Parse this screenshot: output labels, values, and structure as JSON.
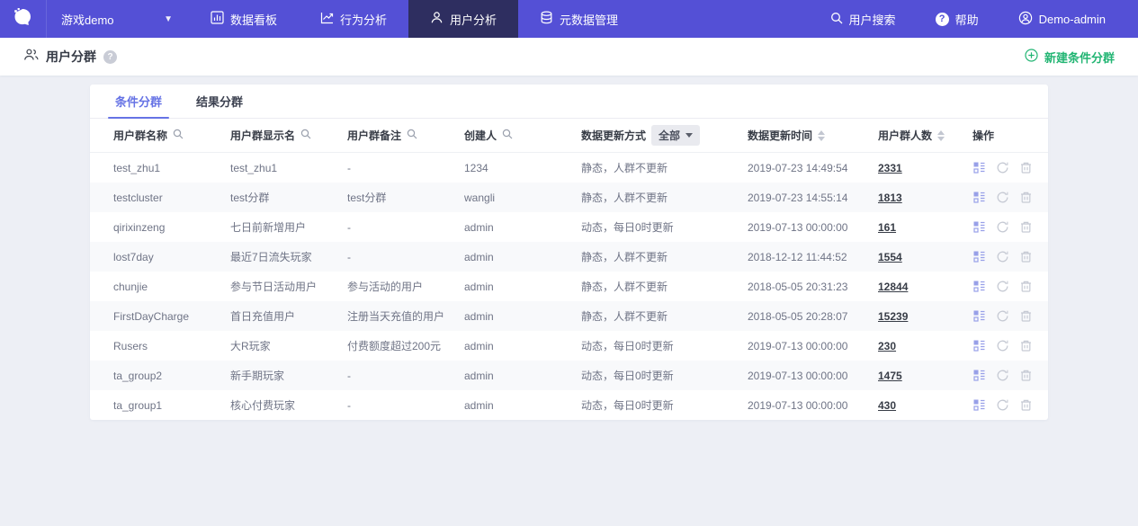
{
  "navbar": {
    "project": "游戏demo",
    "items": [
      {
        "label": "数据看板",
        "active": false
      },
      {
        "label": "行为分析",
        "active": false
      },
      {
        "label": "用户分析",
        "active": true
      },
      {
        "label": "元数据管理",
        "active": false
      }
    ],
    "search_label": "用户搜索",
    "help_label": "帮助",
    "user_label": "Demo-admin"
  },
  "page_header": {
    "title": "用户分群",
    "new_button_label": "新建条件分群"
  },
  "tabs": [
    {
      "label": "条件分群",
      "active": true
    },
    {
      "label": "结果分群",
      "active": false
    }
  ],
  "table": {
    "columns": {
      "name": "用户群名称",
      "display_name": "用户群显示名",
      "remark": "用户群备注",
      "creator": "创建人",
      "update_mode": "数据更新方式",
      "update_time": "数据更新时间",
      "count": "用户群人数",
      "ops": "操作"
    },
    "update_mode_filter": "全部",
    "rows": [
      {
        "name": "test_zhu1",
        "display_name": "test_zhu1",
        "remark": "-",
        "creator": "1234",
        "update_mode": "静态，人群不更新",
        "update_time": "2019-07-23 14:49:54",
        "count": "2331"
      },
      {
        "name": "testcluster",
        "display_name": "test分群",
        "remark": "test分群",
        "creator": "wangli",
        "update_mode": "静态，人群不更新",
        "update_time": "2019-07-23 14:55:14",
        "count": "1813"
      },
      {
        "name": "qirixinzeng",
        "display_name": "七日前新增用户",
        "remark": "-",
        "creator": "admin",
        "update_mode": "动态，每日0时更新",
        "update_time": "2019-07-13 00:00:00",
        "count": "161"
      },
      {
        "name": "lost7day",
        "display_name": "最近7日流失玩家",
        "remark": "-",
        "creator": "admin",
        "update_mode": "静态，人群不更新",
        "update_time": "2018-12-12 11:44:52",
        "count": "1554"
      },
      {
        "name": "chunjie",
        "display_name": "参与节日活动用户",
        "remark": "参与活动的用户",
        "creator": "admin",
        "update_mode": "静态，人群不更新",
        "update_time": "2018-05-05 20:31:23",
        "count": "12844"
      },
      {
        "name": "FirstDayCharge",
        "display_name": "首日充值用户",
        "remark": "注册当天充值的用户",
        "creator": "admin",
        "update_mode": "静态，人群不更新",
        "update_time": "2018-05-05 20:28:07",
        "count": "15239"
      },
      {
        "name": "Rusers",
        "display_name": "大R玩家",
        "remark": "付费额度超过200元",
        "creator": "admin",
        "update_mode": "动态，每日0时更新",
        "update_time": "2019-07-13 00:00:00",
        "count": "230"
      },
      {
        "name": "ta_group2",
        "display_name": "新手期玩家",
        "remark": "-",
        "creator": "admin",
        "update_mode": "动态，每日0时更新",
        "update_time": "2019-07-13 00:00:00",
        "count": "1475"
      },
      {
        "name": "ta_group1",
        "display_name": "核心付费玩家",
        "remark": "-",
        "creator": "admin",
        "update_mode": "动态，每日0时更新",
        "update_time": "2019-07-13 00:00:00",
        "count": "430"
      }
    ]
  },
  "colors": {
    "navbar": "#5450d6",
    "navbar_active": "#2e2e60",
    "accent_green": "#22b573",
    "accent_purple": "#6673e5",
    "content_bg": "#edeff5"
  }
}
